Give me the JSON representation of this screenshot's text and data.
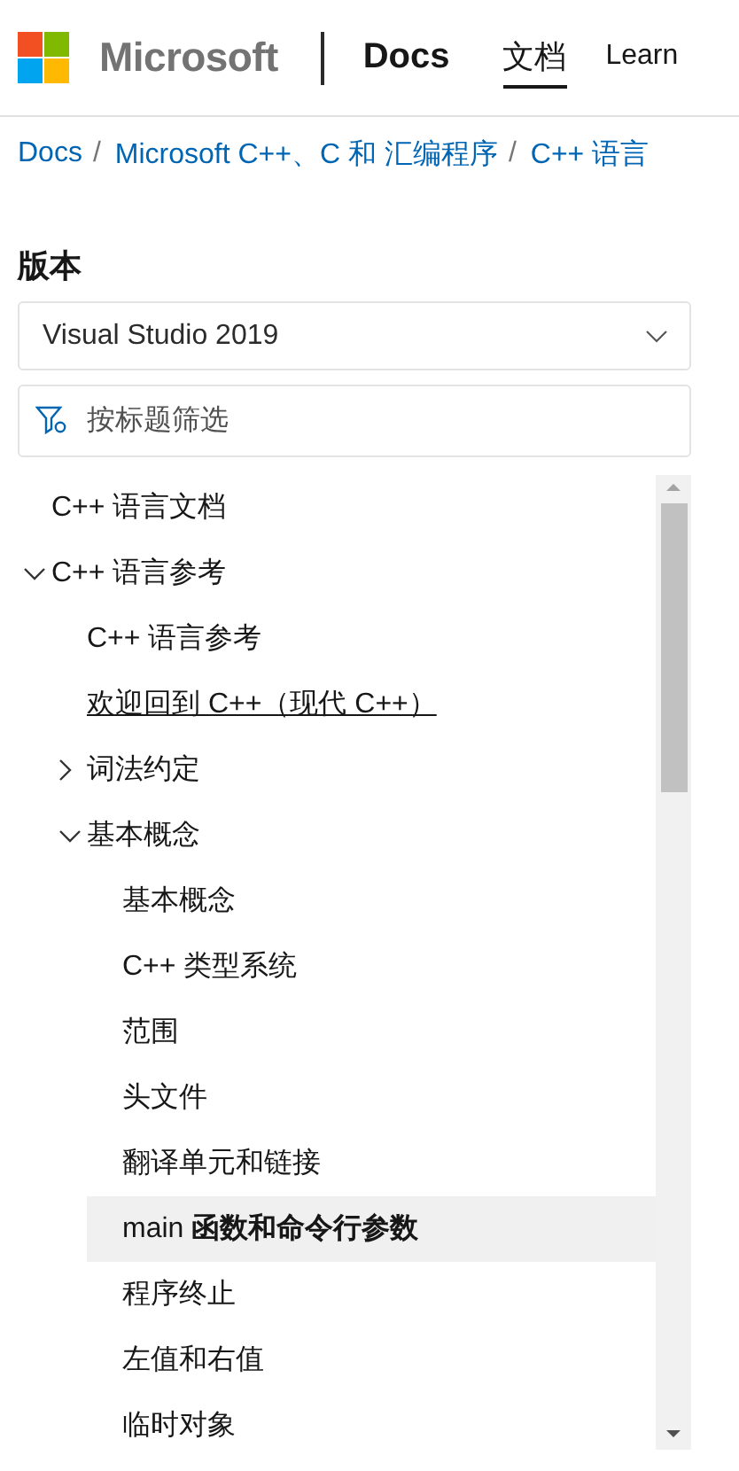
{
  "header": {
    "logo_text": "Microsoft",
    "site": "Docs",
    "nav": [
      {
        "label": "文档",
        "selected": true
      },
      {
        "label": "Learn",
        "selected": false
      }
    ]
  },
  "breadcrumb": [
    {
      "kind": "link",
      "text": "Docs"
    },
    {
      "kind": "separator",
      "text": "/"
    },
    {
      "kind": "link",
      "text": "Microsoft C++、C 和 汇编程序"
    },
    {
      "kind": "separator",
      "text": "/"
    },
    {
      "kind": "link",
      "text": "C++ 语言"
    }
  ],
  "version": {
    "label": "版本",
    "value": "Visual Studio 2019"
  },
  "filter": {
    "placeholder": "按标题筛选"
  },
  "toc": [
    {
      "label": "C++ 语言文档",
      "selected": false,
      "hovered": false
    },
    {
      "label": "C++ 语言参考",
      "expanded": true,
      "children": [
        {
          "label": "C++ 语言参考",
          "selected": false,
          "hovered": false
        },
        {
          "label": "欢迎回到 C++（现代 C++）",
          "selected": false,
          "hovered": true
        },
        {
          "label": "词法约定",
          "expanded": false
        },
        {
          "label": "基本概念",
          "expanded": true,
          "children": [
            {
              "label": "基本概念",
              "selected": false,
              "hovered": false
            },
            {
              "label": "C++ 类型系统",
              "selected": false,
              "hovered": false
            },
            {
              "label": "范围",
              "selected": false,
              "hovered": false
            },
            {
              "label": "头文件",
              "selected": false,
              "hovered": false
            },
            {
              "label": "翻译单元和链接",
              "selected": false,
              "hovered": false
            },
            {
              "label": "main **函数和命令行参数**",
              "selected": true,
              "hovered": false
            },
            {
              "label": "程序终止",
              "selected": false,
              "hovered": false
            },
            {
              "label": "左值和右值",
              "selected": false,
              "hovered": false
            },
            {
              "label": "临时对象",
              "selected": false,
              "hovered": false
            }
          ]
        }
      ]
    }
  ]
}
